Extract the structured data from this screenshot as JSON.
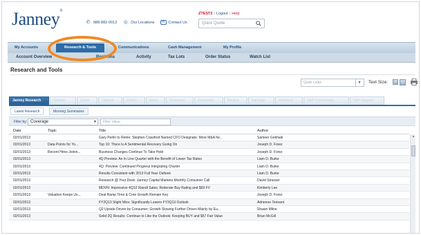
{
  "brand": {
    "logo": "Janney",
    "logo_mark": "®"
  },
  "header": {
    "phone": "888-882-0012",
    "locations": "Our Locations",
    "contact": "Contact Us",
    "user": "ZTEST2",
    "logout": "Logout",
    "help": "Help",
    "quick_quote_placeholder": "Quick Quote"
  },
  "nav": {
    "items": [
      "My Accounts",
      "Research & Tools",
      "Communications",
      "Cash Management",
      "My Profile"
    ],
    "active": "Research & Tools"
  },
  "subnav": {
    "items": [
      "Account Overview",
      "Positions",
      "Activity",
      "Tax Lots",
      "Order Status",
      "Watch List"
    ]
  },
  "page": {
    "title": "Research and Tools"
  },
  "tools": {
    "quick_links_placeholder": "Quick Links",
    "text_size_label": "Text Size:"
  },
  "research_tabs": {
    "items": [
      "Janney Research",
      "Markets",
      "Quote",
      "Options",
      "Charts",
      "News",
      "Screeners",
      "Financials",
      "Analyst",
      "Earnings",
      "Historical",
      "S&P Commentary",
      "S&P Support"
    ],
    "active": "Janney Research"
  },
  "research_subtabs": {
    "items": [
      "Latest Research",
      "Morning Summaries"
    ],
    "active": "Latest Research"
  },
  "filter": {
    "label": "Filter by:",
    "selected": "Coverage",
    "value_placeholder": "Filter Value"
  },
  "table": {
    "columns": [
      "Date",
      "Topic",
      "Title",
      "Author"
    ],
    "rows": [
      [
        "02/01/2013",
        "",
        "Gary Perlin to Retire; Stephen Crawford Named CFO Designate. More M&A for...",
        "Sameer Gokhale"
      ],
      [
        "02/01/2013",
        "Data Points for Yo...",
        "Top 10: There Is A Sentimental Recovery Going On",
        "Joseph D. Forez"
      ],
      [
        "02/01/2013",
        "Recent Hires Joinin...",
        "Business Changes Continue To Take Hold",
        "Joseph D. Forez"
      ],
      [
        "02/01/2013",
        "",
        "4Q Preview: An In Line Quarter with the Benefit of Lower Tax Rates",
        "Liam D. Burke"
      ],
      [
        "02/01/2013",
        "",
        "4Q: Preview: Continued Progress Integrating Charter",
        "Liam D. Burke"
      ],
      [
        "02/01/2013",
        "",
        "Results Consistent with 2013 Full Year Outlook",
        "Liam D. Burke"
      ],
      [
        "02/01/2013",
        "",
        "Research @ Your Desk: Janney Capital Markets Monthly Consumer Call",
        "David Strasser"
      ],
      [
        "02/01/2013",
        "",
        "MDVN: Impressive 4Q12 Xtandi Sales; Reiterate Buy Rating and $69 FV",
        "Kimberly Lee"
      ],
      [
        "02/01/2013",
        "Valuation Keeps Us...",
        "Deal Ramp Time & Core Growth Remain Key",
        "Joseph D. Forez"
      ],
      [
        "02/01/2013",
        "",
        "FY2Q13 Slight Miss: Significantly Lowers FY3Q13 Outlook",
        "Adrienne Tennant"
      ],
      [
        "02/01/2013",
        "",
        "Q2 Upside Driven by Consumer; Growth Slowing Further Driven Mainly by Eu...",
        "Shawn Milne"
      ],
      [
        "02/01/2013",
        "",
        "Solid 2Q Results: Continue to Like the Outlook; Keeping BUY and $57 Fair Value",
        "Brian McGill"
      ]
    ]
  },
  "colors": {
    "brand": "#1f4e80",
    "nav_active": "#2d6ca6",
    "highlight": "#ef8a24",
    "user_red": "#c8102e"
  }
}
